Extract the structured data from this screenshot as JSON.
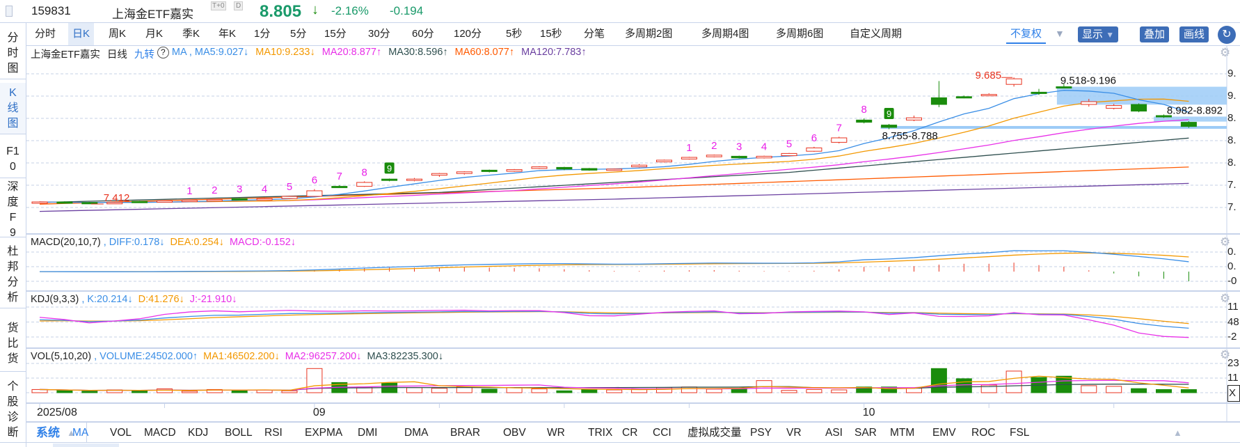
{
  "header": {
    "code": "159831",
    "name": "上海金ETF嘉实",
    "badge_t0": "T+0",
    "badge_d": "D",
    "price": "8.805",
    "change_pct": "-2.16%",
    "change": "-0.194",
    "down_color": "#1a9a6a"
  },
  "periods": [
    "分时",
    "日K",
    "周K",
    "月K",
    "季K",
    "年K",
    "1分",
    "5分",
    "15分",
    "30分",
    "60分",
    "120分",
    "5秒",
    "15秒",
    "分笔",
    "多周期2图",
    "多周期4图",
    "多周期6图",
    "自定义周期"
  ],
  "active_period": "日K",
  "toolbar_right": {
    "adjust": "不复权",
    "display": "显示",
    "overlay": "叠加",
    "draw": "画线"
  },
  "sidebar": [
    {
      "label": "分时图"
    },
    {
      "label": "K线图",
      "active": true
    },
    {
      "label": "F10"
    },
    {
      "label": "深度F9"
    },
    {
      "label": "杜邦分析"
    },
    {
      "label": "货比货"
    },
    {
      "label": "个股诊断"
    }
  ],
  "price_legend": {
    "name": "上海金ETF嘉实",
    "period": "日线",
    "jiuzhuan": "九转",
    "ma_label": "MA ,",
    "ma5": "MA5:9.027↓",
    "ma10": "MA10:9.233↓",
    "ma20": "MA20:8.877↑",
    "ma30": "MA30:8.596↑",
    "ma60": "MA60:8.077↑",
    "ma120": "MA120:7.783↑"
  },
  "macd_legend": {
    "title": "MACD(20,10,7)",
    "sep": ",",
    "diff": "DIFF:0.178↓",
    "dea": "DEA:0.254↓",
    "macd": "MACD:-0.152↓"
  },
  "kdj_legend": {
    "title": "KDJ(9,3,3)",
    "sep": ",",
    "k": "K:20.214↓",
    "d": "D:41.276↓",
    "j": "J:-21.910↓"
  },
  "vol_legend": {
    "title": "VOL(5,10,20)",
    "sep": ",",
    "volume": "VOLUME:24502.000↑",
    "ma1": "MA1:46502.200↓",
    "ma2": "MA2:96257.200↓",
    "ma3": "MA3:82235.300↓"
  },
  "axes": {
    "price": [
      "9.",
      "9.",
      "8.",
      "8.",
      "8.",
      "7.",
      "7."
    ],
    "macd": [
      "0.",
      "0.",
      "-0"
    ],
    "kdj": [
      "11",
      "48",
      "-2"
    ],
    "vol": [
      "23",
      "11"
    ],
    "vol_unit": "X"
  },
  "colors": {
    "up": "#e8321e",
    "down": "#1a8c0c",
    "ma5": "#3a8ee6",
    "ma10": "#f39800",
    "ma20": "#e830e8",
    "ma30": "#2f4f4f",
    "ma60": "#ff5a00",
    "ma120": "#6a3fa0",
    "box": "#9ccbf7"
  },
  "chart_data": {
    "type": "candlestick",
    "price_ylim": [
      7.0,
      10.0
    ],
    "price_grid": [
      9.75,
      9.35,
      8.95,
      8.55,
      8.15,
      7.75,
      7.35
    ],
    "candles": [
      [
        7.43,
        7.46,
        7.42,
        7.45
      ],
      [
        7.45,
        7.46,
        7.43,
        7.44
      ],
      [
        7.44,
        7.45,
        7.412,
        7.43
      ],
      [
        7.43,
        7.45,
        7.42,
        7.44
      ],
      [
        7.46,
        7.47,
        7.44,
        7.45
      ],
      [
        7.45,
        7.48,
        7.44,
        7.47
      ],
      [
        7.46,
        7.49,
        7.45,
        7.48
      ],
      [
        7.47,
        7.5,
        7.46,
        7.49
      ],
      [
        7.51,
        7.52,
        7.49,
        7.5
      ],
      [
        7.49,
        7.52,
        7.48,
        7.51
      ],
      [
        7.51,
        7.56,
        7.5,
        7.55
      ],
      [
        7.55,
        7.68,
        7.54,
        7.65
      ],
      [
        7.73,
        7.75,
        7.7,
        7.72
      ],
      [
        7.73,
        7.82,
        7.72,
        7.8
      ],
      [
        7.86,
        7.87,
        7.82,
        7.84
      ],
      [
        7.84,
        7.88,
        7.82,
        7.86
      ],
      [
        7.93,
        7.97,
        7.9,
        7.96
      ],
      [
        7.96,
        8.0,
        7.94,
        7.99
      ],
      [
        8.02,
        8.03,
        7.98,
        8.0
      ],
      [
        8.0,
        8.04,
        7.99,
        8.03
      ],
      [
        8.05,
        8.09,
        8.04,
        8.08
      ],
      [
        8.07,
        8.08,
        8.02,
        8.04
      ],
      [
        8.05,
        8.06,
        8.01,
        8.02
      ],
      [
        8.02,
        8.05,
        8.01,
        8.04
      ],
      [
        8.08,
        8.13,
        8.07,
        8.11
      ],
      [
        8.17,
        8.21,
        8.16,
        8.2
      ],
      [
        8.22,
        8.26,
        8.21,
        8.25
      ],
      [
        8.26,
        8.3,
        8.25,
        8.29
      ],
      [
        8.27,
        8.28,
        8.23,
        8.24
      ],
      [
        8.24,
        8.28,
        8.23,
        8.27
      ],
      [
        8.28,
        8.33,
        8.27,
        8.32
      ],
      [
        8.36,
        8.44,
        8.35,
        8.42
      ],
      [
        8.52,
        8.62,
        8.5,
        8.6
      ],
      [
        8.92,
        8.95,
        8.86,
        8.88
      ],
      [
        8.83,
        8.85,
        8.755,
        8.788
      ],
      [
        8.92,
        9.0,
        8.9,
        8.96
      ],
      [
        9.32,
        9.62,
        9.15,
        9.2
      ],
      [
        9.34,
        9.36,
        9.31,
        9.32
      ],
      [
        9.36,
        9.4,
        9.35,
        9.38
      ],
      [
        9.56,
        9.685,
        9.52,
        9.66
      ],
      [
        9.42,
        9.48,
        9.37,
        9.4
      ],
      [
        9.518,
        9.57,
        9.5,
        9.51
      ],
      [
        9.2,
        9.3,
        9.16,
        9.25
      ],
      [
        9.13,
        9.21,
        9.11,
        9.18
      ],
      [
        9.2,
        9.22,
        9.06,
        9.08
      ],
      [
        9.0,
        9.02,
        8.96,
        8.98
      ],
      [
        8.88,
        8.9,
        8.78,
        8.805
      ]
    ],
    "volumes": [
      25000,
      18000,
      12000,
      22000,
      15000,
      30000,
      12000,
      25000,
      20000,
      22000,
      15000,
      190000,
      80000,
      45000,
      75000,
      40000,
      35000,
      45000,
      28000,
      40000,
      30000,
      15000,
      25000,
      22000,
      30000,
      40000,
      45000,
      28000,
      35000,
      95000,
      18000,
      25000,
      22000,
      45000,
      45000,
      35000,
      190000,
      110000,
      60000,
      170000,
      120000,
      130000,
      55000,
      50000,
      32000,
      25000,
      24502
    ],
    "vol_ylim": [
      0,
      230000
    ],
    "kdj_ylim": [
      -20,
      116
    ],
    "ma_anchors": {
      "ma30": [
        [
          0,
          7.44
        ],
        [
          16,
          7.62
        ],
        [
          30,
          7.98
        ],
        [
          46,
          8.596
        ]
      ],
      "ma60": [
        [
          0,
          7.41
        ],
        [
          23,
          7.7
        ],
        [
          46,
          8.077
        ]
      ],
      "ma120": [
        [
          0,
          7.28
        ],
        [
          23,
          7.5
        ],
        [
          46,
          7.783
        ]
      ]
    },
    "jiuzhuan": [
      {
        "start": 6,
        "end": 14
      },
      {
        "start": 26,
        "end": 34
      }
    ],
    "annotations": {
      "low": {
        "index": 2,
        "label": "7.412",
        "value": 7.412
      },
      "high": {
        "index": 39,
        "label": "9.685",
        "value": 9.685
      },
      "zone1": {
        "from": 41,
        "label": "9.518-9.196",
        "top": 9.518,
        "bottom": 9.196
      },
      "zone2": {
        "from": 44.6,
        "label": "8.982-8.892",
        "top": 8.982,
        "bottom": 8.892
      },
      "line1": {
        "from": 34,
        "label": "8.755-8.788",
        "value": 8.788
      }
    },
    "x_labels": [
      {
        "index": 0,
        "label": "2025/08"
      },
      {
        "index": 11,
        "label": "09"
      },
      {
        "index": 33,
        "label": "10"
      }
    ]
  },
  "indicator_tabs": {
    "system": "系统",
    "items": [
      "MA",
      "VOL",
      "MACD",
      "KDJ",
      "BOLL",
      "RSI",
      "EXPMA",
      "DMI",
      "DMA",
      "BRAR",
      "OBV",
      "WR",
      "TRIX",
      "CR",
      "CCI",
      "虚拟成交量",
      "PSY",
      "VR",
      "ASI",
      "SAR",
      "MTM",
      "EMV",
      "ROC",
      "FSL"
    ],
    "active": "MA"
  }
}
